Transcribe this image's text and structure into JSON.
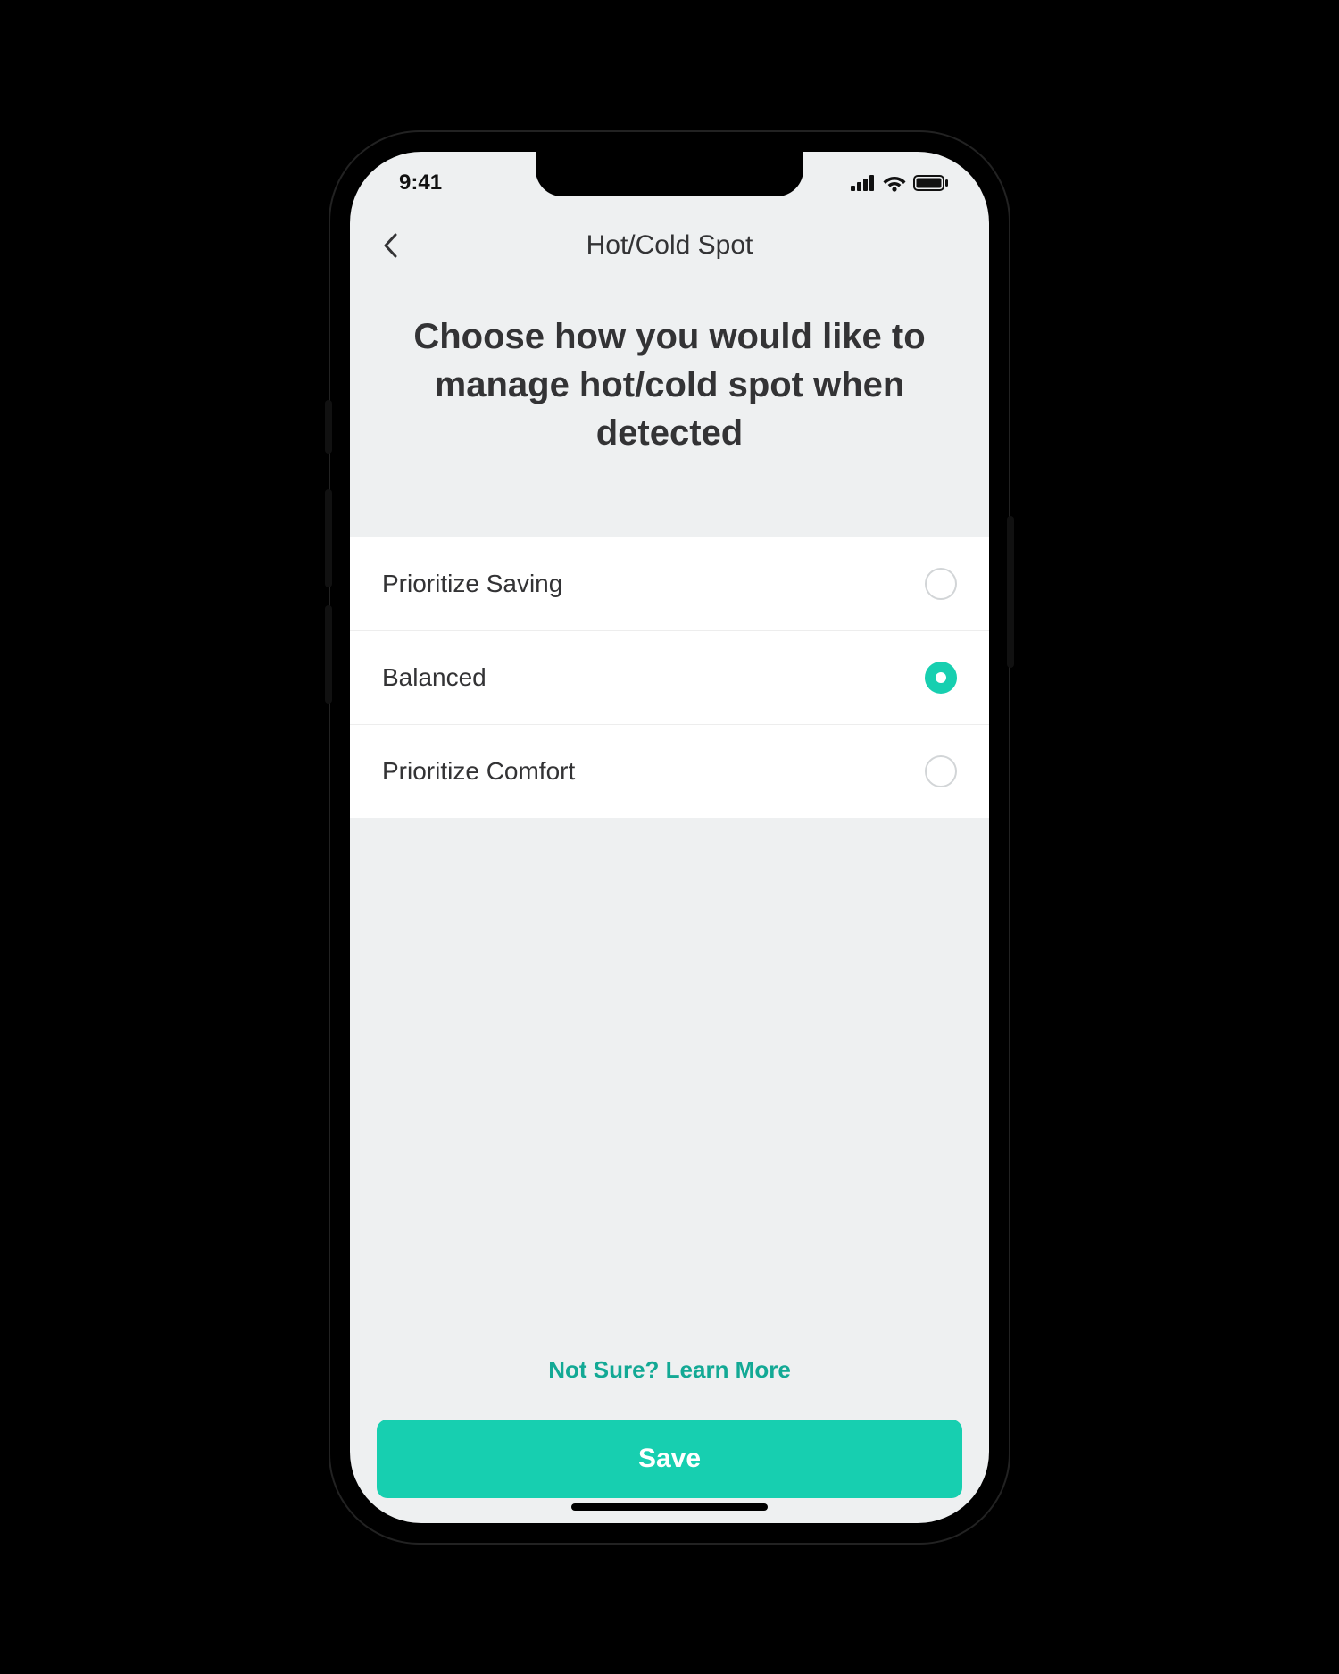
{
  "status": {
    "time": "9:41"
  },
  "nav": {
    "title": "Hot/Cold Spot"
  },
  "heading": "Choose how you would like to manage hot/cold spot when detected",
  "options": [
    {
      "label": "Prioritize Saving",
      "selected": false
    },
    {
      "label": "Balanced",
      "selected": true
    },
    {
      "label": "Prioritize Comfort",
      "selected": false
    }
  ],
  "footer": {
    "learn_more": "Not Sure? Learn More",
    "save": "Save"
  },
  "colors": {
    "accent": "#17cfb0",
    "accent_dark": "#13a995",
    "bg": "#eef0f1",
    "text": "#333335"
  }
}
